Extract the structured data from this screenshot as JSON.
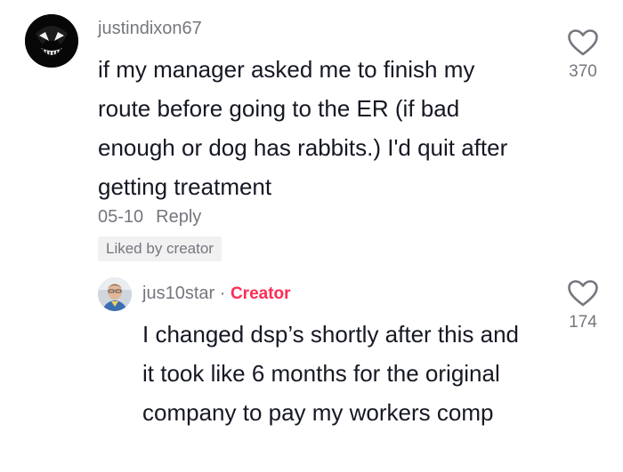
{
  "comment": {
    "username": "justindixon67",
    "text": "if my manager asked me to finish my route before going to the ER (if bad enough or dog has rabbits.) I'd quit after getting treatment",
    "date": "05-10",
    "reply_label": "Reply",
    "liked_badge": "Liked by creator",
    "like_count": "370"
  },
  "reply": {
    "username": "jus10star",
    "separator": "·",
    "creator_tag": "Creator",
    "text": "I changed dsp’s shortly after this and it took like 6 months for the original company to pay my workers comp",
    "like_count": "174"
  },
  "colors": {
    "text_primary": "#161823",
    "text_secondary": "#75777e",
    "creator_accent": "#fe2c55",
    "badge_bg": "#f1f1f2"
  },
  "icons": {
    "like": "heart-outline-icon"
  }
}
